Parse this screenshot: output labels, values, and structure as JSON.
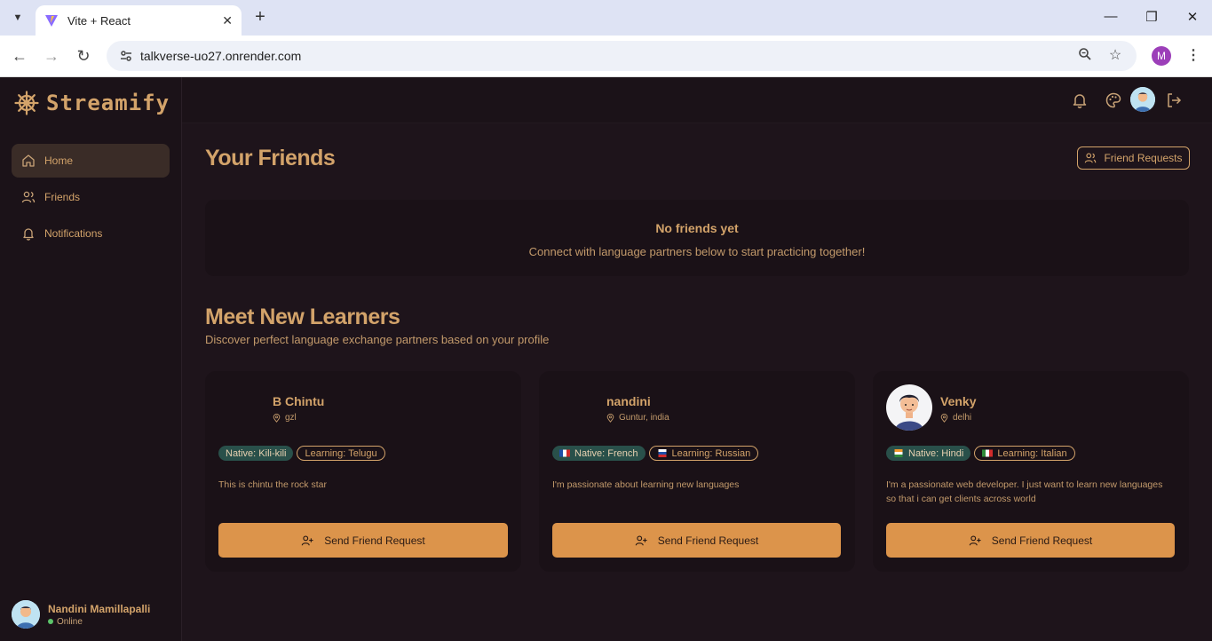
{
  "browser": {
    "tab_title": "Vite + React",
    "url": "talkverse-uo27.onrender.com",
    "profile_initial": "M"
  },
  "app": {
    "logo_text": "Streamify",
    "nav": [
      {
        "label": "Home",
        "active": true
      },
      {
        "label": "Friends",
        "active": false
      },
      {
        "label": "Notifications",
        "active": false
      }
    ],
    "user": {
      "name": "Nandini Mamillapalli",
      "status": "Online"
    }
  },
  "friends": {
    "title": "Your Friends",
    "requests_button": "Friend Requests",
    "empty_title": "No friends yet",
    "empty_subtitle": "Connect with language partners below to start practicing together!"
  },
  "learners": {
    "title": "Meet New Learners",
    "subtitle": "Discover perfect language exchange partners based on your profile",
    "cards": [
      {
        "name": "B Chintu",
        "location": "gzl",
        "native": "Native: Kili-kili",
        "learning": "Learning: Telugu",
        "native_flag": "",
        "learning_flag": "",
        "bio": "This is chintu the rock star",
        "button": "Send Friend Request",
        "has_avatar": false
      },
      {
        "name": "nandini",
        "location": "Guntur, india",
        "native": "Native: French",
        "learning": "Learning: Russian",
        "native_flag": "fr",
        "learning_flag": "ru",
        "bio": "I'm passionate about learning new languages",
        "button": "Send Friend Request",
        "has_avatar": false
      },
      {
        "name": "Venky",
        "location": "delhi",
        "native": "Native: Hindi",
        "learning": "Learning: Italian",
        "native_flag": "in",
        "learning_flag": "it",
        "bio": "I'm a passionate web developer. I just want to learn new languages so that i can get clients across world",
        "button": "Send Friend Request",
        "has_avatar": true
      }
    ]
  },
  "colors": {
    "accent": "#d3a36a",
    "button": "#dc944b",
    "background": "#1e141b",
    "native_badge": "#29504a"
  }
}
